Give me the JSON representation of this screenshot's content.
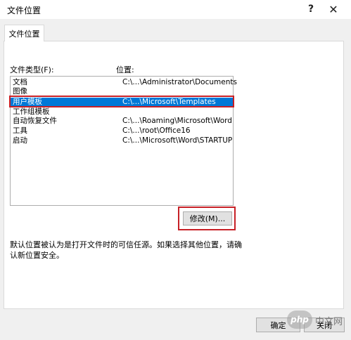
{
  "window": {
    "title": "文件位置",
    "help_glyph": "?",
    "close_glyph": "✕"
  },
  "tab": {
    "label": "文件位置"
  },
  "list": {
    "type_header": "文件类型(F):",
    "location_header": "位置:",
    "rows": [
      {
        "type": "文档",
        "path": "C:\\...\\Administrator\\Documents"
      },
      {
        "type": "图像",
        "path": ""
      },
      {
        "type": "用户模板",
        "path": "C:\\...\\Microsoft\\Templates"
      },
      {
        "type": "工作组模板",
        "path": ""
      },
      {
        "type": "自动恢复文件",
        "path": "C:\\...\\Roaming\\Microsoft\\Word"
      },
      {
        "type": "工具",
        "path": "C:\\...\\root\\Office16"
      },
      {
        "type": "启动",
        "path": "C:\\...\\Microsoft\\Word\\STARTUP"
      }
    ],
    "selected_index": 2
  },
  "buttons": {
    "modify": "修改(M)...",
    "ok": "确定",
    "close": "关闭"
  },
  "note": "默认位置被认为是打开文件时的可信任源。如果选择其他位置，请确认新位置安全。",
  "watermark": {
    "badge": "php",
    "text": "中文网"
  },
  "colors": {
    "selection": "#0078d7",
    "highlight_border": "#c72026",
    "dialog_bg": "#f0f0f0"
  }
}
